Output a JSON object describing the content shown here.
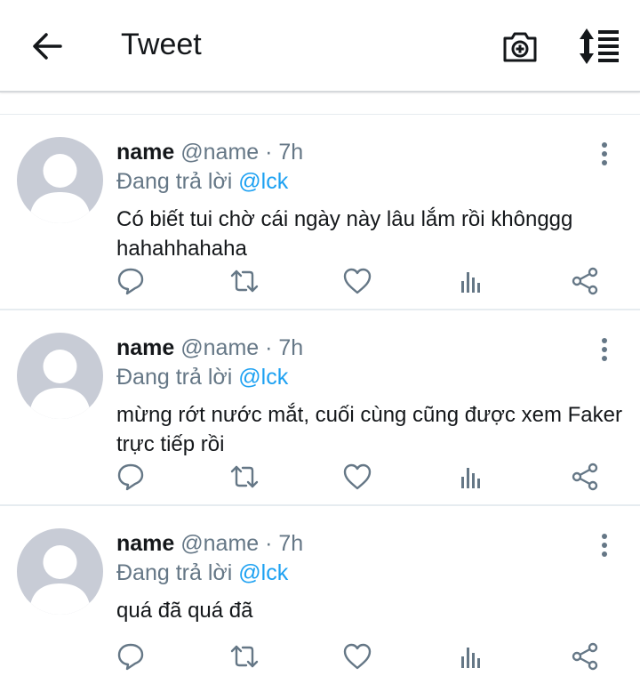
{
  "header": {
    "title": "Tweet",
    "back_icon": "arrow-left-icon",
    "camera_icon": "camera-plus-icon",
    "sort_icon": "sort-list-icon"
  },
  "colors": {
    "mention": "#1da1f2",
    "secondary_text": "#657786",
    "primary_text": "#14171a",
    "avatar_bg": "#c8ccd6"
  },
  "tweets": [
    {
      "name": "name",
      "handle_time": "@name · 7h",
      "reply_prefix": "Đang trả lời",
      "reply_to": "@lck",
      "text": "Có biết tui chờ cái ngày này lâu lắm rồi khônggg hahahhahaha"
    },
    {
      "name": "name",
      "handle_time": "@name · 7h",
      "reply_prefix": "Đang trả lời",
      "reply_to": "@lck",
      "text": "mừng rớt nước mắt, cuối cùng cũng được xem Faker trực tiếp rồi"
    },
    {
      "name": "name",
      "handle_time": "@name · 7h",
      "reply_prefix": "Đang trả lời",
      "reply_to": "@lck",
      "text": "quá đã quá đã"
    }
  ],
  "action_icons": [
    "reply-icon",
    "retweet-icon",
    "like-icon",
    "stats-icon",
    "share-icon"
  ]
}
